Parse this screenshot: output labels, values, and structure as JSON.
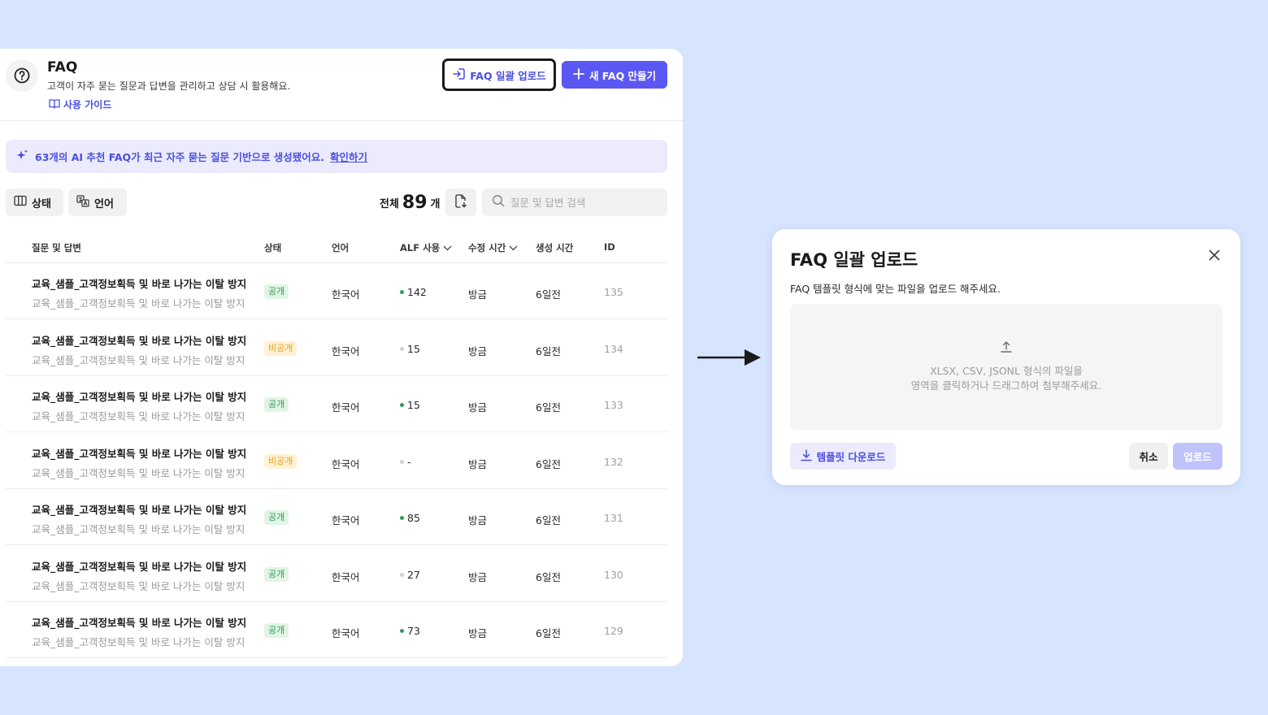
{
  "colors": {
    "background": "#d6e4fe",
    "accent": "#5b57f2",
    "link": "#4b4fe0",
    "public": "#2f9c55",
    "private": "#e3a31f"
  },
  "header": {
    "title": "FAQ",
    "description": "고객이 자주 묻는 질문과 답변을 관리하고 상담 시 활용해요.",
    "guide_label": "사용 가이드",
    "bulk_upload_label": "FAQ 일괄 업로드",
    "new_faq_label": "새 FAQ 만들기"
  },
  "ai_banner": {
    "text": "63개의 AI 추천 FAQ가 최근 자주 묻는 질문 기반으로 생성됐어요.",
    "link": "확인하기"
  },
  "filters": {
    "status_label": "상태",
    "language_label": "언어"
  },
  "summary": {
    "total_label": "전체",
    "total_count": "89",
    "total_unit": "개"
  },
  "search": {
    "placeholder": "질문 및 답변 검색"
  },
  "table": {
    "columns": {
      "qa": "질문 및 답변",
      "status": "상태",
      "language": "언어",
      "alf": "ALF 사용",
      "modified": "수정 시간",
      "created": "생성 시간",
      "id": "ID"
    },
    "rows": [
      {
        "question": "교육_샘플_고객정보획득 및 바로 나가는 이탈 방지",
        "answer": "교육_샘플_고객정보획득 및 바로 나가는 이탈 방지",
        "status": "공개",
        "status_type": "pub",
        "language": "한국어",
        "alf": "142",
        "alf_active": true,
        "modified": "방금",
        "created": "6일전",
        "id": "135"
      },
      {
        "question": "교육_샘플_고객정보획득 및 바로 나가는 이탈 방지",
        "answer": "교육_샘플_고객정보획득 및 바로 나가는 이탈 방지",
        "status": "비공개",
        "status_type": "priv",
        "language": "한국어",
        "alf": "15",
        "alf_active": false,
        "modified": "방금",
        "created": "6일전",
        "id": "134"
      },
      {
        "question": "교육_샘플_고객정보획득 및 바로 나가는 이탈 방지",
        "answer": "교육_샘플_고객정보획득 및 바로 나가는 이탈 방지",
        "status": "공개",
        "status_type": "pub",
        "language": "한국어",
        "alf": "15",
        "alf_active": true,
        "modified": "방금",
        "created": "6일전",
        "id": "133"
      },
      {
        "question": "교육_샘플_고객정보획득 및 바로 나가는 이탈 방지",
        "answer": "교육_샘플_고객정보획득 및 바로 나가는 이탈 방지",
        "status": "비공개",
        "status_type": "priv",
        "language": "한국어",
        "alf": "-",
        "alf_active": false,
        "modified": "방금",
        "created": "6일전",
        "id": "132"
      },
      {
        "question": "교육_샘플_고객정보획득 및 바로 나가는 이탈 방지",
        "answer": "교육_샘플_고객정보획득 및 바로 나가는 이탈 방지",
        "status": "공개",
        "status_type": "pub",
        "language": "한국어",
        "alf": "85",
        "alf_active": true,
        "modified": "방금",
        "created": "6일전",
        "id": "131"
      },
      {
        "question": "교육_샘플_고객정보획득 및 바로 나가는 이탈 방지",
        "answer": "교육_샘플_고객정보획득 및 바로 나가는 이탈 방지",
        "status": "공개",
        "status_type": "pub",
        "language": "한국어",
        "alf": "27",
        "alf_active": false,
        "modified": "방금",
        "created": "6일전",
        "id": "130"
      },
      {
        "question": "교육_샘플_고객정보획득 및 바로 나가는 이탈 방지",
        "answer": "교육_샘플_고객정보획득 및 바로 나가는 이탈 방지",
        "status": "공개",
        "status_type": "pub",
        "language": "한국어",
        "alf": "73",
        "alf_active": true,
        "modified": "방금",
        "created": "6일전",
        "id": "129"
      }
    ]
  },
  "modal": {
    "title": "FAQ 일괄 업로드",
    "description": "FAQ 템플릿 형식에 맞는 파일을 업로드 해주세요.",
    "dropzone_line1": "XLSX, CSV, JSONL 형식의 파일을",
    "dropzone_line2": "영역을 클릭하거나 드래그하여 첨부해주세요.",
    "template_download_label": "템플릿 다운로드",
    "cancel_label": "취소",
    "upload_label": "업로드"
  }
}
